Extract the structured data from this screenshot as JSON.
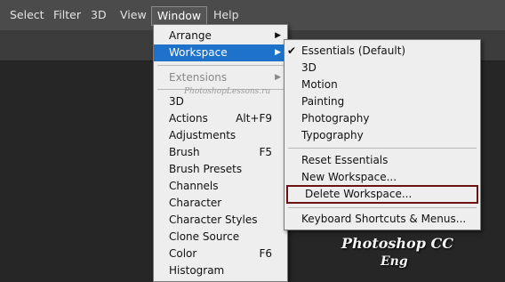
{
  "menubar": {
    "items": [
      "Select",
      "Filter",
      "3D",
      "View",
      "Window",
      "Help"
    ]
  },
  "window_menu": {
    "arrange": "Arrange",
    "workspace": "Workspace",
    "extensions": "Extensions",
    "items": [
      {
        "label": "3D",
        "shortcut": ""
      },
      {
        "label": "Actions",
        "shortcut": "Alt+F9"
      },
      {
        "label": "Adjustments",
        "shortcut": ""
      },
      {
        "label": "Brush",
        "shortcut": "F5"
      },
      {
        "label": "Brush Presets",
        "shortcut": ""
      },
      {
        "label": "Channels",
        "shortcut": ""
      },
      {
        "label": "Character",
        "shortcut": ""
      },
      {
        "label": "Character Styles",
        "shortcut": ""
      },
      {
        "label": "Clone Source",
        "shortcut": ""
      },
      {
        "label": "Color",
        "shortcut": "F6"
      },
      {
        "label": "Histogram",
        "shortcut": ""
      }
    ]
  },
  "workspace_menu": {
    "checkmark": "✔",
    "presets": [
      "Essentials (Default)",
      "3D",
      "Motion",
      "Painting",
      "Photography",
      "Typography"
    ],
    "reset": "Reset Essentials",
    "new": "New Workspace...",
    "delete": "Delete Workspace...",
    "shortcuts": "Keyboard Shortcuts & Menus..."
  },
  "watermark": "PhotoshopLessons.ru",
  "brand": {
    "line1": "Photoshop  CC",
    "line2": "Eng"
  },
  "icons": {
    "submenu_arrow": "caret-right-icon",
    "check": "checkmark-icon"
  },
  "colors": {
    "highlight": "#1f72c9",
    "box": "#6b1212",
    "menu_bg": "#eeeeee",
    "menubar_bg": "#4b4b4b"
  }
}
